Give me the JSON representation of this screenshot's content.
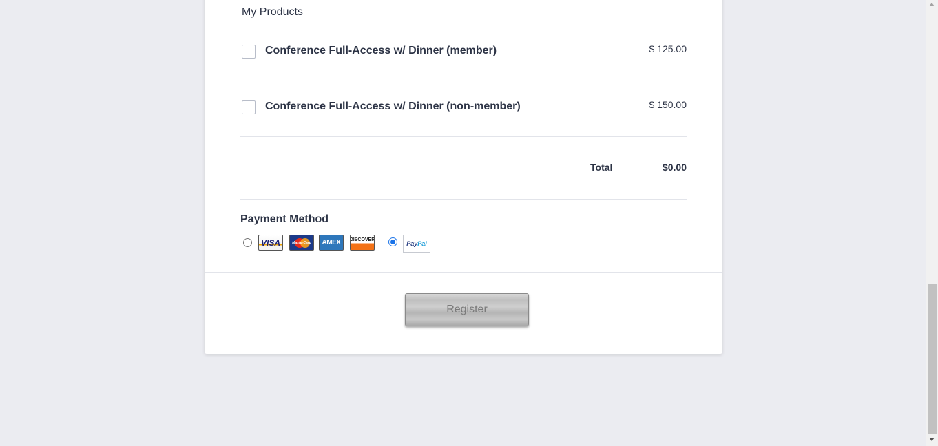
{
  "products": {
    "section_title": "My Products",
    "items": [
      {
        "name": "Conference Full-Access w/ Dinner (member)",
        "price": "$ 125.00",
        "checked": false
      },
      {
        "name": "Conference Full-Access w/ Dinner (non-member)",
        "price": "$ 150.00",
        "checked": false
      }
    ],
    "total_label": "Total",
    "total_value": "$0.00"
  },
  "payment": {
    "title": "Payment Method",
    "options": [
      {
        "id": "credit-card",
        "selected": false,
        "logos": [
          "VISA",
          "MasterCard",
          "AMEX",
          "DISCOVER"
        ]
      },
      {
        "id": "paypal",
        "selected": true,
        "logo_parts": [
          "Pay",
          "Pal"
        ]
      }
    ]
  },
  "register": {
    "label": "Register"
  },
  "colors": {
    "page_background": "#ebecf1",
    "text": "#2c3345",
    "radio_selected": "#1a73e8"
  }
}
